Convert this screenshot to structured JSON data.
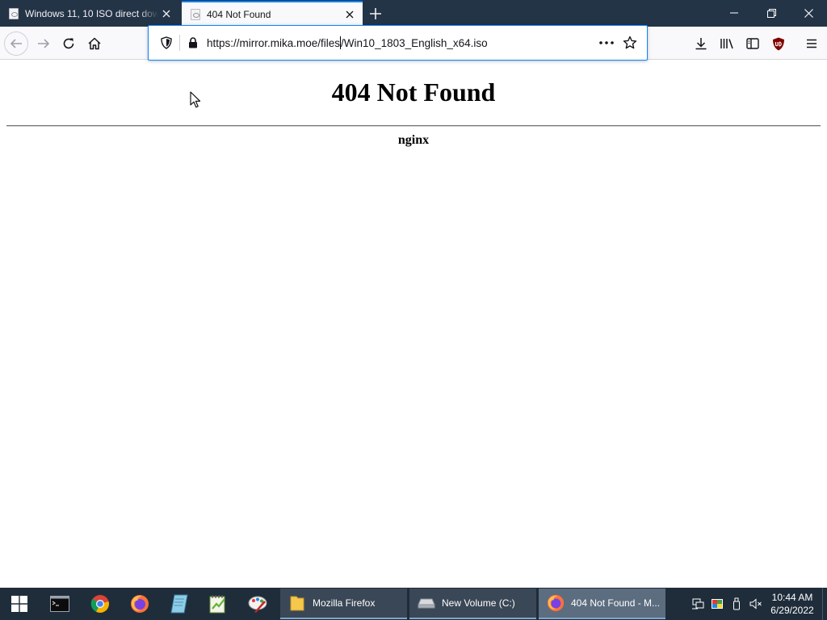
{
  "tabs": [
    {
      "title": "Windows 11, 10 ISO direct downloads",
      "active": false,
      "favicon": "page-icon"
    },
    {
      "title": "404 Not Found",
      "active": true,
      "favicon": "page-icon"
    }
  ],
  "window_controls": {
    "minimize_icon": "minimize-icon",
    "restore_icon": "restore-icon",
    "close_icon": "close-icon"
  },
  "navbar": {
    "url": "https://mirror.mika.moe/files/Win10_1803_English_x64.iso",
    "url_before_caret": "https://mirror.mika.moe/files",
    "url_after_caret": "/Win10_1803_English_x64.iso"
  },
  "page": {
    "heading": "404 Not Found",
    "server": "nginx"
  },
  "taskbar": {
    "windows": [
      {
        "label": "Mozilla Firefox",
        "icon": "folder-icon"
      },
      {
        "label": "New Volume (C:)",
        "icon": "drive-icon"
      },
      {
        "label": "404 Not Found - M...",
        "icon": "firefox-icon",
        "active": true
      }
    ],
    "clock": {
      "time": "10:44 AM",
      "date": "6/29/2022"
    }
  },
  "colors": {
    "tabstrip": "#243447",
    "active_tab_accent": "#0a84ff",
    "taskbar": "#1f2d3b",
    "ublock": "#800000"
  }
}
